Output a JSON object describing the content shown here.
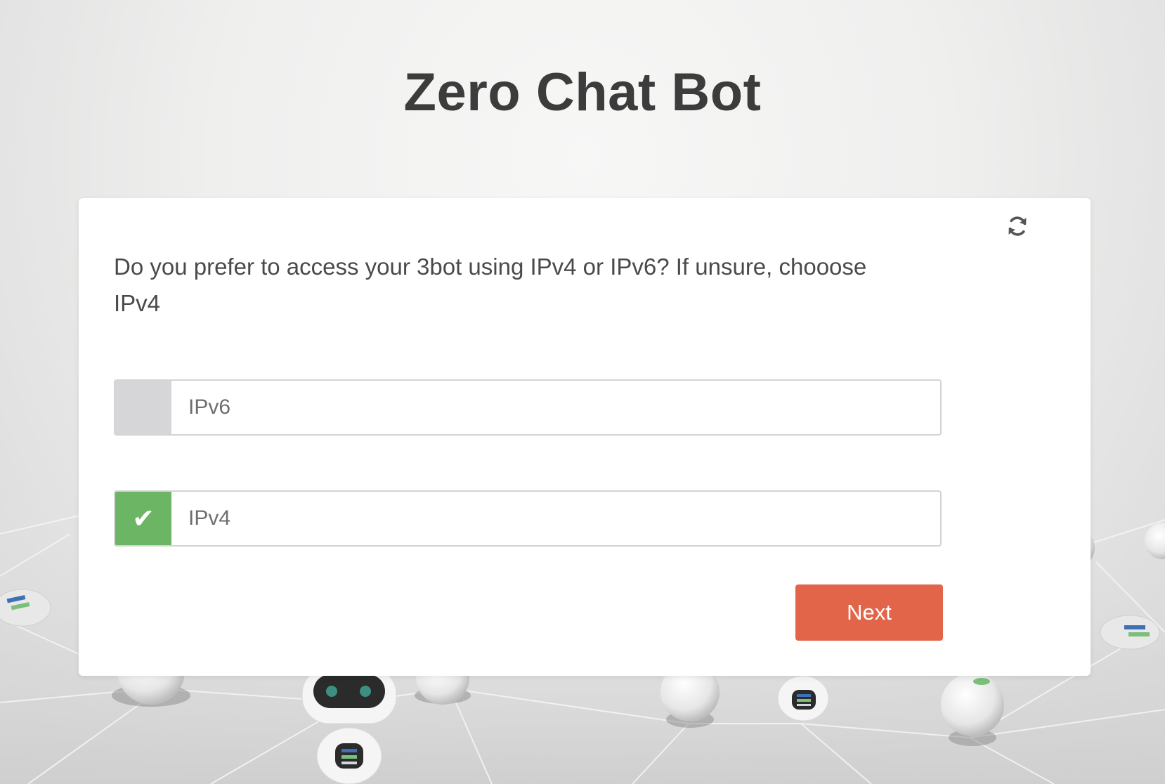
{
  "app": {
    "title": "Zero Chat Bot"
  },
  "card": {
    "question": "Do you prefer to access your 3bot using IPv4 or IPv6? If unsure, chooose IPv4",
    "refresh_icon": "refresh-icon",
    "options": [
      {
        "label": "IPv6",
        "selected": false
      },
      {
        "label": "IPv4",
        "selected": true,
        "check_glyph": "✔"
      }
    ],
    "next_label": "Next"
  },
  "colors": {
    "selected": "#6cb565",
    "unselected": "#d6d6d8",
    "accent": "#e2654a",
    "title": "#3c3c3c"
  }
}
